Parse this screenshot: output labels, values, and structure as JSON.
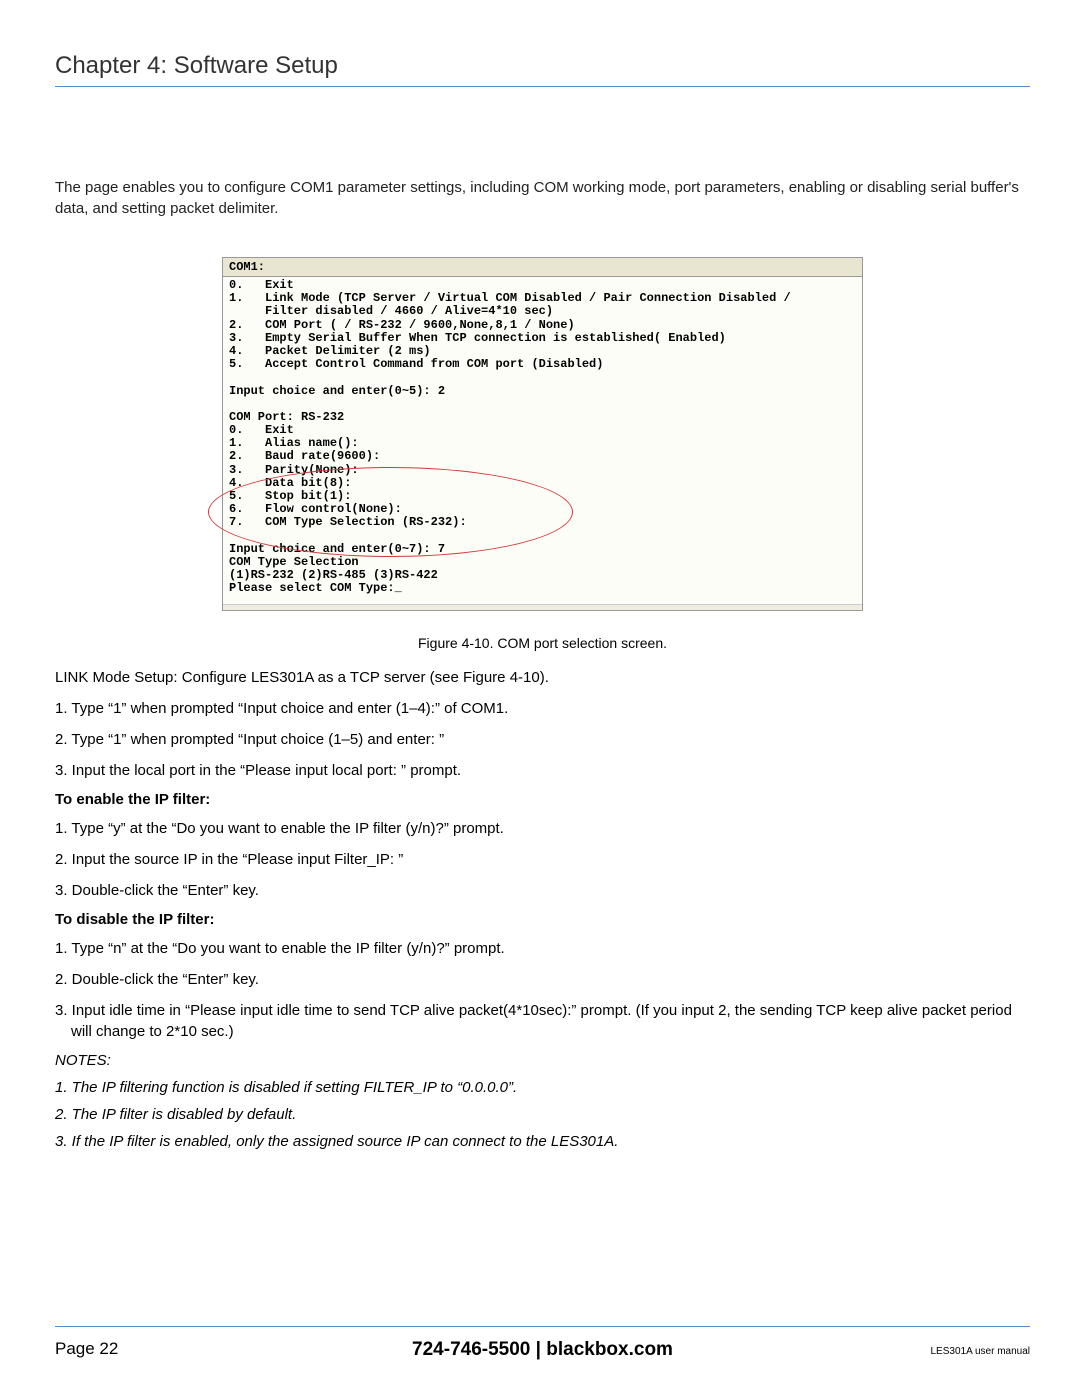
{
  "chapter_title": "Chapter 4: Software Setup",
  "intro": "The page enables you to configure COM1 parameter settings, including COM working mode, port parameters, enabling or disabling serial buffer's data, and setting packet delimiter.",
  "terminal": {
    "header": "COM1:",
    "body": "0.   Exit\n1.   Link Mode (TCP Server / Virtual COM Disabled / Pair Connection Disabled /\n     Filter disabled / 4660 / Alive=4*10 sec)\n2.   COM Port ( / RS-232 / 9600,None,8,1 / None)\n3.   Empty Serial Buffer When TCP connection is established( Enabled)\n4.   Packet Delimiter (2 ms)\n5.   Accept Control Command from COM port (Disabled)\n\nInput choice and enter(0~5): 2\n\nCOM Port: RS-232\n0.   Exit\n1.   Alias name():\n2.   Baud rate(9600):\n3.   Parity(None):\n4.   Data bit(8):\n5.   Stop bit(1):\n6.   Flow control(None):\n7.   COM Type Selection (RS-232):\n\nInput choice and enter(0~7): 7\nCOM Type Selection\n(1)RS-232 (2)RS-485 (3)RS-422\nPlease select COM Type:_"
  },
  "figure_caption": "Figure 4-10. COM port selection screen.",
  "link_mode_intro": "LINK Mode Setup: Configure LES301A as a TCP server (see Figure 4-10).",
  "steps_main": [
    "1. Type “1” when prompted “Input choice and enter (1–4):” of COM1.",
    "2. Type “1” when prompted “Input choice (1–5) and enter: ”",
    "3. Input the local port in the “Please input local port: ”  prompt."
  ],
  "enable_heading": "To enable the IP filter:",
  "steps_enable": [
    "1. Type “y” at the “Do you want to enable the IP filter (y/n)?” prompt.",
    "2. Input the source IP in the “Please input Filter_IP: ”",
    "3. Double-click the “Enter” key."
  ],
  "disable_heading": "To disable the IP filter:",
  "steps_disable": [
    "1. Type “n” at the “Do you want to enable the IP filter (y/n)?” prompt.",
    "2. Double-click the “Enter” key.",
    "3. Input idle time in “Please input idle time to send TCP alive packet(4*10sec):” prompt. (If you input 2, the sending TCP keep alive packet period will change to 2*10 sec.)"
  ],
  "notes_title": "NOTES:",
  "notes": [
    "1. The IP filtering function is disabled if setting FILTER_IP to “0.0.0.0”.",
    "2. The IP filter is disabled by default.",
    "3. If the IP filter is enabled, only the assigned source IP can connect to the LES301A."
  ],
  "footer": {
    "page": "Page 22",
    "center": "724-746-5500   |   blackbox.com",
    "right": "LES301A user manual"
  }
}
